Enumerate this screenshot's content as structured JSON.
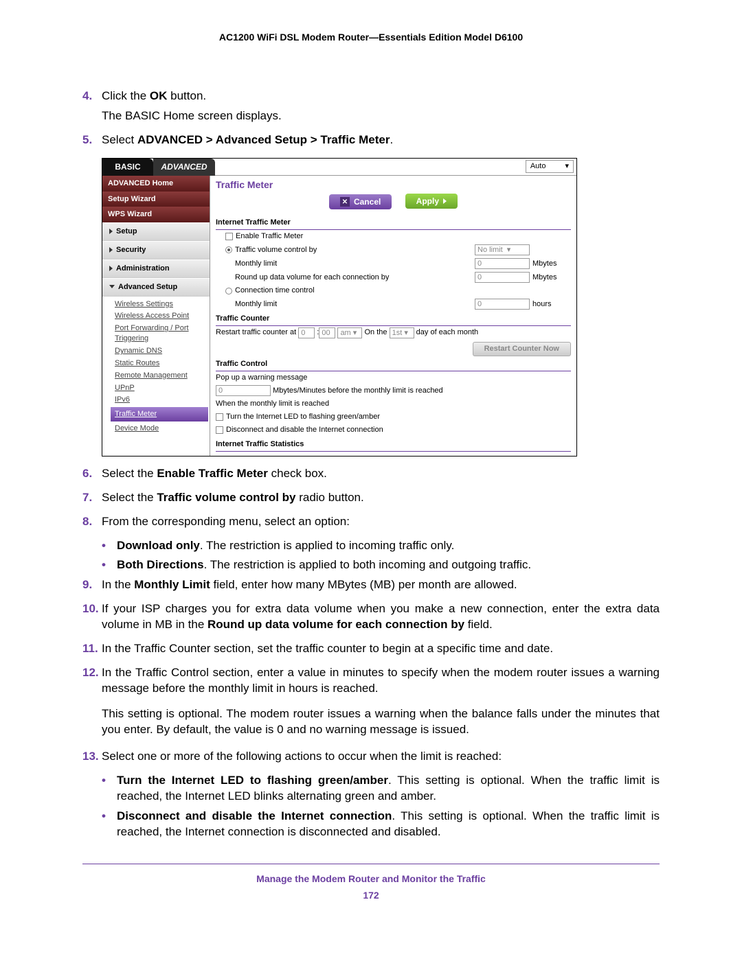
{
  "header": "AC1200 WiFi DSL Modem Router—Essentials Edition Model D6100",
  "steps": {
    "s4": {
      "num": "4.",
      "l1a": "Click the ",
      "l1b": "OK",
      "l1c": " button.",
      "l2": "The BASIC Home screen displays."
    },
    "s5": {
      "num": "5.",
      "l1a": "Select ",
      "l1b": "ADVANCED > Advanced Setup > Traffic Meter",
      "l1c": "."
    },
    "s6": {
      "num": "6.",
      "a": "Select the ",
      "b": "Enable Traffic Meter",
      "c": " check box."
    },
    "s7": {
      "num": "7.",
      "a": "Select the ",
      "b": "Traffic volume control by",
      "c": " radio button."
    },
    "s8": {
      "num": "8.",
      "text": "From the corresponding menu, select an option:"
    },
    "s8b1": {
      "b": "Download only",
      "t": ". The restriction is applied to incoming traffic only."
    },
    "s8b2": {
      "b": "Both Directions",
      "t": ". The restriction is applied to both incoming and outgoing traffic."
    },
    "s9": {
      "num": "9.",
      "a": "In the ",
      "b": "Monthly Limit",
      "c": " field, enter how many MBytes (MB) per month are allowed."
    },
    "s10": {
      "num": "10.",
      "a": "If your ISP charges you for extra data volume when you make a new connection, enter the extra data volume in MB in the ",
      "b": "Round up data volume for each connection by",
      "c": " field."
    },
    "s11": {
      "num": "11.",
      "text": "In the Traffic Counter section, set the traffic counter to begin at a specific time and date."
    },
    "s12": {
      "num": "12.",
      "p1": "In the Traffic Control section, enter a value in minutes to specify when the modem router issues a warning message before the monthly limit in hours is reached.",
      "p2": "This setting is optional. The modem router issues a warning when the balance falls under the minutes that you enter. By default, the value is 0 and no warning message is issued."
    },
    "s13": {
      "num": "13.",
      "text": "Select one or more of the following actions to occur when the limit is reached:"
    },
    "s13b1": {
      "b": "Turn the Internet LED to flashing green/amber",
      "t": ". This setting is optional. When the traffic limit is reached, the Internet LED blinks alternating green and amber."
    },
    "s13b2": {
      "b": "Disconnect and disable the Internet connection",
      "t": ". This setting is optional. When the traffic limit is reached, the Internet connection is disconnected and disabled."
    }
  },
  "ui": {
    "tabs": {
      "basic": "BASIC",
      "advanced": "ADVANCED"
    },
    "auto": "Auto",
    "sidebar": {
      "advanced_home": "ADVANCED Home",
      "setup_wizard": "Setup Wizard",
      "wps_wizard": "WPS Wizard",
      "setup": "Setup",
      "security": "Security",
      "administration": "Administration",
      "advanced_setup": "Advanced Setup",
      "sub": {
        "wireless_settings": "Wireless Settings",
        "wireless_ap": "Wireless Access Point",
        "port_fwd": "Port Forwarding / Port Triggering",
        "ddns": "Dynamic DNS",
        "static_routes": "Static Routes",
        "remote_mgmt": "Remote Management",
        "upnp": "UPnP",
        "ipv6": "IPv6",
        "traffic_meter": "Traffic Meter",
        "device_mode": "Device Mode"
      }
    },
    "main": {
      "title": "Traffic Meter",
      "cancel": "Cancel",
      "apply": "Apply",
      "sec1": "Internet Traffic Meter",
      "enable": "Enable Traffic Meter",
      "vol_ctrl": "Traffic volume control by",
      "no_limit": "No limit",
      "monthly_limit": "Monthly limit",
      "mbytes": "Mbytes",
      "roundup": "Round up data volume for each connection by",
      "conn_time": "Connection time control",
      "hours": "hours",
      "zero": "0",
      "sec2": "Traffic Counter",
      "restart_at": "Restart traffic counter at",
      "min00": "00",
      "ampm": "am",
      "on_the": "On the",
      "first": "1st",
      "day_of": "day of each month",
      "restart_btn": "Restart Counter Now",
      "sec3": "Traffic Control",
      "popup": "Pop up a warning message",
      "before": "Mbytes/Minutes before the monthly limit is reached",
      "when_reached": "When the monthly limit is reached",
      "led_flash": "Turn the Internet LED to flashing green/amber",
      "disconnect": "Disconnect and disable the Internet connection",
      "sec4": "Internet Traffic Statistics"
    }
  },
  "footer": {
    "title": "Manage the Modem Router and Monitor the Traffic",
    "page": "172"
  }
}
